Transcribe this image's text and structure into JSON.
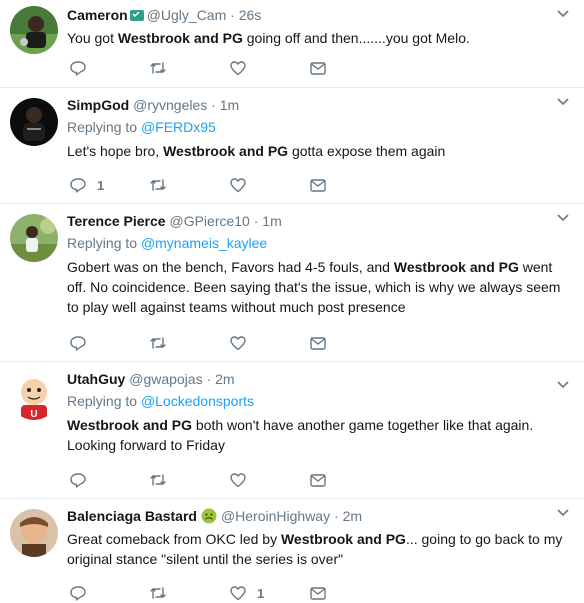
{
  "tweets": [
    {
      "name": "Cameron",
      "handle": "@Ugly_Cam",
      "dot": "·",
      "time": "26s",
      "reply_to_label": "",
      "reply_to_mention": "",
      "text": [
        {
          "t": "You got "
        },
        {
          "t": "Westbrook and PG",
          "b": true
        },
        {
          "t": " going off and then.......you got Melo."
        }
      ],
      "reply_count": "",
      "retweet_count": "",
      "like_count": ""
    },
    {
      "name": "SimpGod",
      "handle": "@ryvngeles",
      "dot": "·",
      "time": "1m",
      "reply_to_label": "Replying to",
      "reply_to_mention": "@FERDx95",
      "text": [
        {
          "t": "Let's hope bro, "
        },
        {
          "t": "Westbrook and PG",
          "b": true
        },
        {
          "t": " gotta expose them again"
        }
      ],
      "reply_count": "1",
      "retweet_count": "",
      "like_count": ""
    },
    {
      "name": "Terence Pierce",
      "handle": "@GPierce10",
      "dot": "·",
      "time": "1m",
      "reply_to_label": "Replying to",
      "reply_to_mention": "@mynameis_kaylee",
      "text": [
        {
          "t": "Gobert was on the bench, Favors had 4-5 fouls, and "
        },
        {
          "t": "Westbrook and PG",
          "b": true
        },
        {
          "t": " went off. No coincidence. Been saying that's the issue, which is why we always seem to play well against teams without much post presence"
        }
      ],
      "reply_count": "",
      "retweet_count": "",
      "like_count": ""
    },
    {
      "name": "UtahGuy",
      "handle": "@gwapojas",
      "dot": "·",
      "time": "2m",
      "reply_to_label": "Replying to",
      "reply_to_mention": "@Lockedonsports",
      "text": [
        {
          "t": "Westbrook and PG",
          "b": true
        },
        {
          "t": " both won't have another game together like that again. Looking forward to Friday"
        }
      ],
      "reply_count": "",
      "retweet_count": "",
      "like_count": ""
    },
    {
      "name": "Balenciaga Bastard",
      "handle": "@HeroinHighway",
      "dot": "·",
      "time": "2m",
      "reply_to_label": "",
      "reply_to_mention": "",
      "text": [
        {
          "t": "Great comeback from OKC led by "
        },
        {
          "t": "Westbrook and PG",
          "b": true
        },
        {
          "t": "... going to go back to my original stance \"silent until the series is over\""
        }
      ],
      "reply_count": "",
      "retweet_count": "",
      "like_count": "1"
    }
  ],
  "icons": {
    "reply": "reply-icon",
    "retweet": "retweet-icon",
    "like": "heart-icon",
    "dm": "envelope-icon",
    "menu": "chevron-down-icon"
  },
  "colors": {
    "name": "#14171a",
    "meta": "#657786",
    "link": "#1da1f2",
    "divider": "#e6ecf0"
  }
}
